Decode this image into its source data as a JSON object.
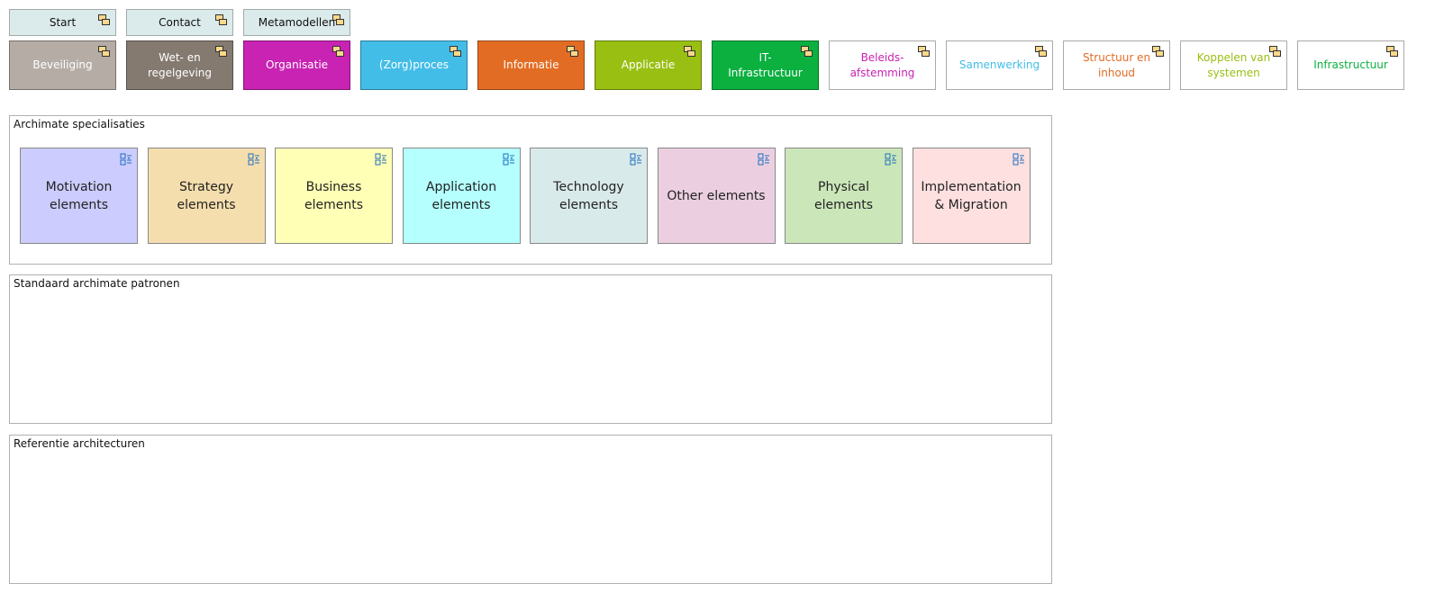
{
  "top_nav": [
    {
      "label": "Start"
    },
    {
      "label": "Contact"
    },
    {
      "label": "Metamodellen"
    }
  ],
  "categories": [
    {
      "label": "Beveiliging",
      "bg": "#b5aca6",
      "fg": "#ffffff"
    },
    {
      "label": "Wet- en regelgeving",
      "bg": "#857a70",
      "fg": "#ffffff"
    },
    {
      "label": "Organisatie",
      "bg": "#c823b3",
      "fg": "#ffffff"
    },
    {
      "label": "(Zorg)proces",
      "bg": "#42bde8",
      "fg": "#ffffff"
    },
    {
      "label": "Informatie",
      "bg": "#e36c24",
      "fg": "#ffffff"
    },
    {
      "label": "Applicatie",
      "bg": "#99bf12",
      "fg": "#ffffff"
    },
    {
      "label": "IT-Infrastructuur",
      "bg": "#0bb03f",
      "fg": "#ffffff"
    },
    {
      "label": "Beleids-afstemming",
      "bg": "#ffffff",
      "fg": "#c823b3"
    },
    {
      "label": "Samenwerking",
      "bg": "#ffffff",
      "fg": "#42bde8"
    },
    {
      "label": "Structuur en inhoud",
      "bg": "#ffffff",
      "fg": "#e36c24"
    },
    {
      "label": "Koppelen van systemen",
      "bg": "#ffffff",
      "fg": "#99bf12"
    },
    {
      "label": "Infrastructuur",
      "bg": "#ffffff",
      "fg": "#0bb03f"
    }
  ],
  "groups": [
    {
      "label": "Archimate specialisaties"
    },
    {
      "label": "Standaard archimate patronen"
    },
    {
      "label": "Referentie architecturen"
    }
  ],
  "elements": [
    {
      "label": "Motivation elements",
      "bg": "#ccccff"
    },
    {
      "label": "Strategy elements",
      "bg": "#f5dead"
    },
    {
      "label": "Business elements",
      "bg": "#ffffb5"
    },
    {
      "label": "Application elements",
      "bg": "#b5ffff"
    },
    {
      "label": "Technology elements",
      "bg": "#d9eaea"
    },
    {
      "label": "Other elements",
      "bg": "#ebcfe1"
    },
    {
      "label": "Physical elements",
      "bg": "#cbe7b9"
    },
    {
      "label": "Implementation & Migration",
      "bg": "#ffe0e0"
    }
  ]
}
